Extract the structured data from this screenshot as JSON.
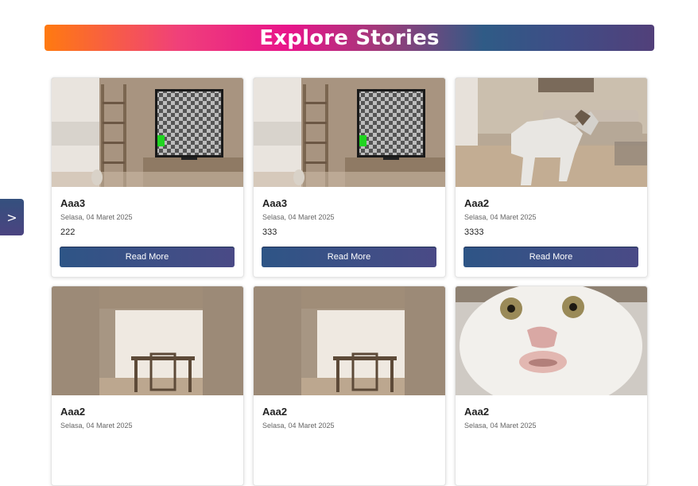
{
  "header": {
    "title": "Explore Stories"
  },
  "sidebar_toggle": {
    "icon": "chevron-right-icon",
    "label": ">"
  },
  "cards": [
    {
      "image": "living-room-tv-checker",
      "title": "Aaa3",
      "date": "Selasa, 04 Maret 2025",
      "body": "222",
      "button": "Read More"
    },
    {
      "image": "living-room-tv-checker",
      "title": "Aaa3",
      "date": "Selasa, 04 Maret 2025",
      "body": "333",
      "button": "Read More"
    },
    {
      "image": "living-room-dog",
      "title": "Aaa2",
      "date": "Selasa, 04 Maret 2025",
      "body": "3333",
      "button": "Read More"
    },
    {
      "image": "dining-room",
      "title": "Aaa2",
      "date": "Selasa, 04 Maret 2025",
      "body": "",
      "button": ""
    },
    {
      "image": "dining-room",
      "title": "Aaa2",
      "date": "Selasa, 04 Maret 2025",
      "body": "",
      "button": ""
    },
    {
      "image": "cat-face",
      "title": "Aaa2",
      "date": "Selasa, 04 Maret 2025",
      "body": "",
      "button": ""
    }
  ],
  "colors": {
    "gradient_start": "#ff7a10",
    "gradient_mid": "#e8148a",
    "gradient_end": "#52407a",
    "button": "#3a4f86"
  }
}
